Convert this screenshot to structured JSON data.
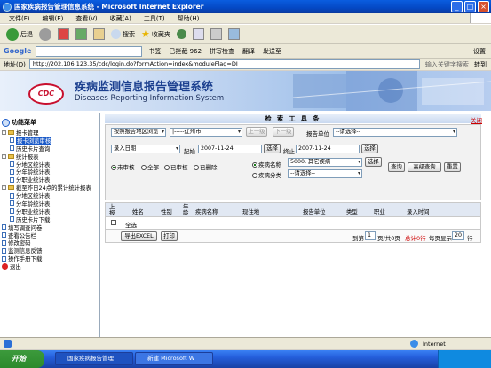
{
  "window": {
    "title": "国家疾病报告管理信息系统 - Microsoft Internet Explorer"
  },
  "menu": [
    "文件(F)",
    "编辑(E)",
    "查看(V)",
    "收藏(A)",
    "工具(T)",
    "帮助(H)"
  ],
  "toolbar": {
    "back": "后退",
    "search": "搜索",
    "favorites": "收藏夹",
    "bookmarks": "书签",
    "blocked": "已拦截 962",
    "spell": "拼写检查",
    "translate": "翻译",
    "send": "发送至",
    "settings": "设置"
  },
  "google": {
    "label": "Google"
  },
  "address": {
    "label": "地址(D)",
    "url": "http://202.106.123.35/cdc/login.do?formAction=index&moduleFlag=DI",
    "hint": "输入关键字搜索",
    "go": "转到"
  },
  "banner": {
    "logo": "CDC",
    "title_cn": "疾病监测信息报告管理系统",
    "title_en": "Diseases Reporting Information System"
  },
  "sidebar": {
    "header": "功能菜单",
    "items": [
      {
        "label": "报卡管理",
        "type": "folder",
        "level": 0
      },
      {
        "label": "报卡浏览审核",
        "type": "doc",
        "level": 1,
        "selected": true
      },
      {
        "label": "历史卡片查询",
        "type": "doc",
        "level": 1
      },
      {
        "label": "统计报表",
        "type": "folder",
        "level": 0
      },
      {
        "label": "分地区统计表",
        "type": "doc",
        "level": 1
      },
      {
        "label": "分年龄统计表",
        "type": "doc",
        "level": 1
      },
      {
        "label": "分职业统计表",
        "type": "doc",
        "level": 1
      },
      {
        "label": "截至昨日24点的累计统计报表",
        "type": "folder",
        "level": 0
      },
      {
        "label": "分地区统计表",
        "type": "doc",
        "level": 1
      },
      {
        "label": "分年龄统计表",
        "type": "doc",
        "level": 1
      },
      {
        "label": "分职业统计表",
        "type": "doc",
        "level": 1
      },
      {
        "label": "历史卡片下载",
        "type": "doc",
        "level": 1
      },
      {
        "label": "填写调查问卷",
        "type": "doc",
        "level": 0
      },
      {
        "label": "查看公告栏",
        "type": "doc",
        "level": 0
      },
      {
        "label": "修改密码",
        "type": "doc",
        "level": 0
      },
      {
        "label": "监测信息反馈",
        "type": "doc",
        "level": 0
      },
      {
        "label": "操作手册下载",
        "type": "doc",
        "level": 0
      },
      {
        "label": "退出",
        "type": "exit",
        "level": 0
      }
    ]
  },
  "tools": {
    "title": "检 索 工 具 条",
    "close": "关闭",
    "region_mode": "按照报告地区浏览",
    "region": "|-----辽州市",
    "prev_level": "上一级",
    "next_level": "下一级",
    "report_unit_label": "报告单位",
    "report_unit": "--请选择--",
    "date_type": "录入日期",
    "start_label": "起始",
    "start_date": "2007-11-24",
    "select": "选择",
    "end_label": "终止",
    "end_date": "2007-11-24",
    "audit_options": [
      "未审核",
      "全部",
      "已审核",
      "已删除"
    ],
    "disease_name_label": "疾病名称",
    "disease_name": "5000, 其它疾病",
    "disease_class_label": "疾病分类",
    "disease_class": "--请选择--",
    "query": "查询",
    "advanced_query": "高级查询",
    "reset": "重置"
  },
  "grid": {
    "columns": [
      "上报",
      "姓名",
      "性别",
      "年龄",
      "疾病名称",
      "现住地",
      "报告单位",
      "类型",
      "职业",
      "录入时间"
    ],
    "select_all": "全选",
    "export": "导出EXCEL",
    "print": "打印",
    "goto_label": "到第",
    "page": "1",
    "page_total": "页/共0页",
    "total_rows": "总计0行",
    "page_size_label": "每页显示",
    "page_size": "20",
    "rows_unit": "行"
  },
  "statusbar": {
    "zone": "Internet"
  },
  "taskbar": {
    "start": "开始",
    "tasks": [
      "国家疾病报告管理",
      "新建 Microsoft W"
    ]
  }
}
